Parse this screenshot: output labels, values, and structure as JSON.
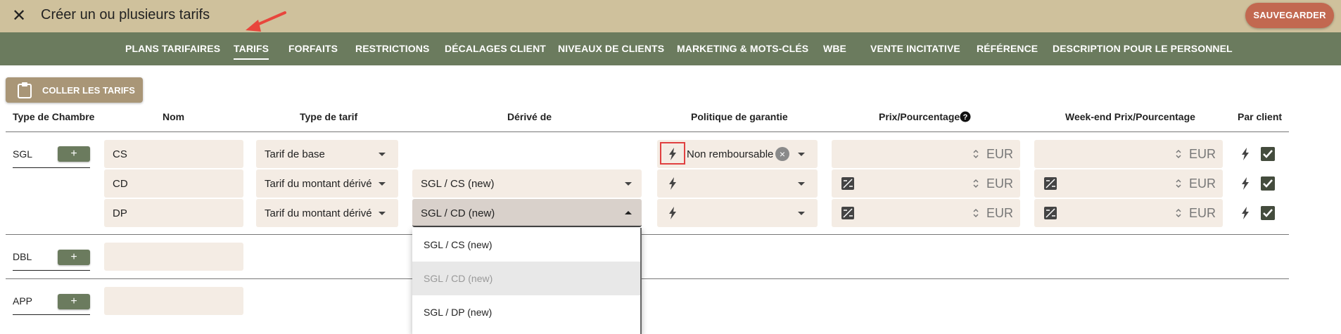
{
  "header": {
    "title": "Créer un ou plusieurs tarifs",
    "save_label": "SAUVEGARDER",
    "close_glyph": "✕"
  },
  "nav": {
    "tabs": [
      {
        "label": "PLANS TARIFAIRES"
      },
      {
        "label": "TARIFS",
        "active": true
      },
      {
        "label": "FORFAITS"
      },
      {
        "label": "RESTRICTIONS"
      },
      {
        "label": "DÉCALAGES CLIENT"
      },
      {
        "label": "NIVEAUX DE CLIENTS"
      },
      {
        "label": "MARKETING & MOTS-CLÉS"
      },
      {
        "label": "WBE"
      },
      {
        "label": "VENTE INCITATIVE"
      },
      {
        "label": "RÉFÉRENCE"
      },
      {
        "label": "DESCRIPTION POUR LE PERSONNEL"
      }
    ]
  },
  "toolbar": {
    "paste_label": "COLLER LES TARIFS"
  },
  "table": {
    "headers": {
      "room_type": "Type de Chambre",
      "name": "Nom",
      "rate_type": "Type de tarif",
      "derived_from": "Dérivé de",
      "guarantee_policy": "Politique de garantie",
      "price": "Prix/Pourcentage",
      "weekend_price": "Week-end Prix/Pourcentage",
      "per_guest": "Par client"
    },
    "add_glyph": "+",
    "currency": "EUR",
    "groups": [
      {
        "room": "SGL",
        "rows": [
          {
            "name": "CS",
            "rate_type": "Tarif de base",
            "derived_from": "",
            "policy": "Non remboursable",
            "per_guest": true
          },
          {
            "name": "CD",
            "rate_type": "Tarif du montant dérivé",
            "derived_from": "SGL / CS (new)",
            "policy": "",
            "per_guest": true
          },
          {
            "name": "DP",
            "rate_type": "Tarif du montant dérivé",
            "derived_from": "SGL / CD (new)",
            "policy": "",
            "per_guest": true
          }
        ]
      },
      {
        "room": "DBL",
        "rows": []
      },
      {
        "room": "APP",
        "rows": []
      }
    ]
  },
  "dropdown": {
    "options": [
      {
        "label": "SGL / CS (new)",
        "selected": false
      },
      {
        "label": "SGL / CD (new)",
        "selected": true
      },
      {
        "label": "SGL / DP (new)",
        "selected": false
      }
    ]
  }
}
